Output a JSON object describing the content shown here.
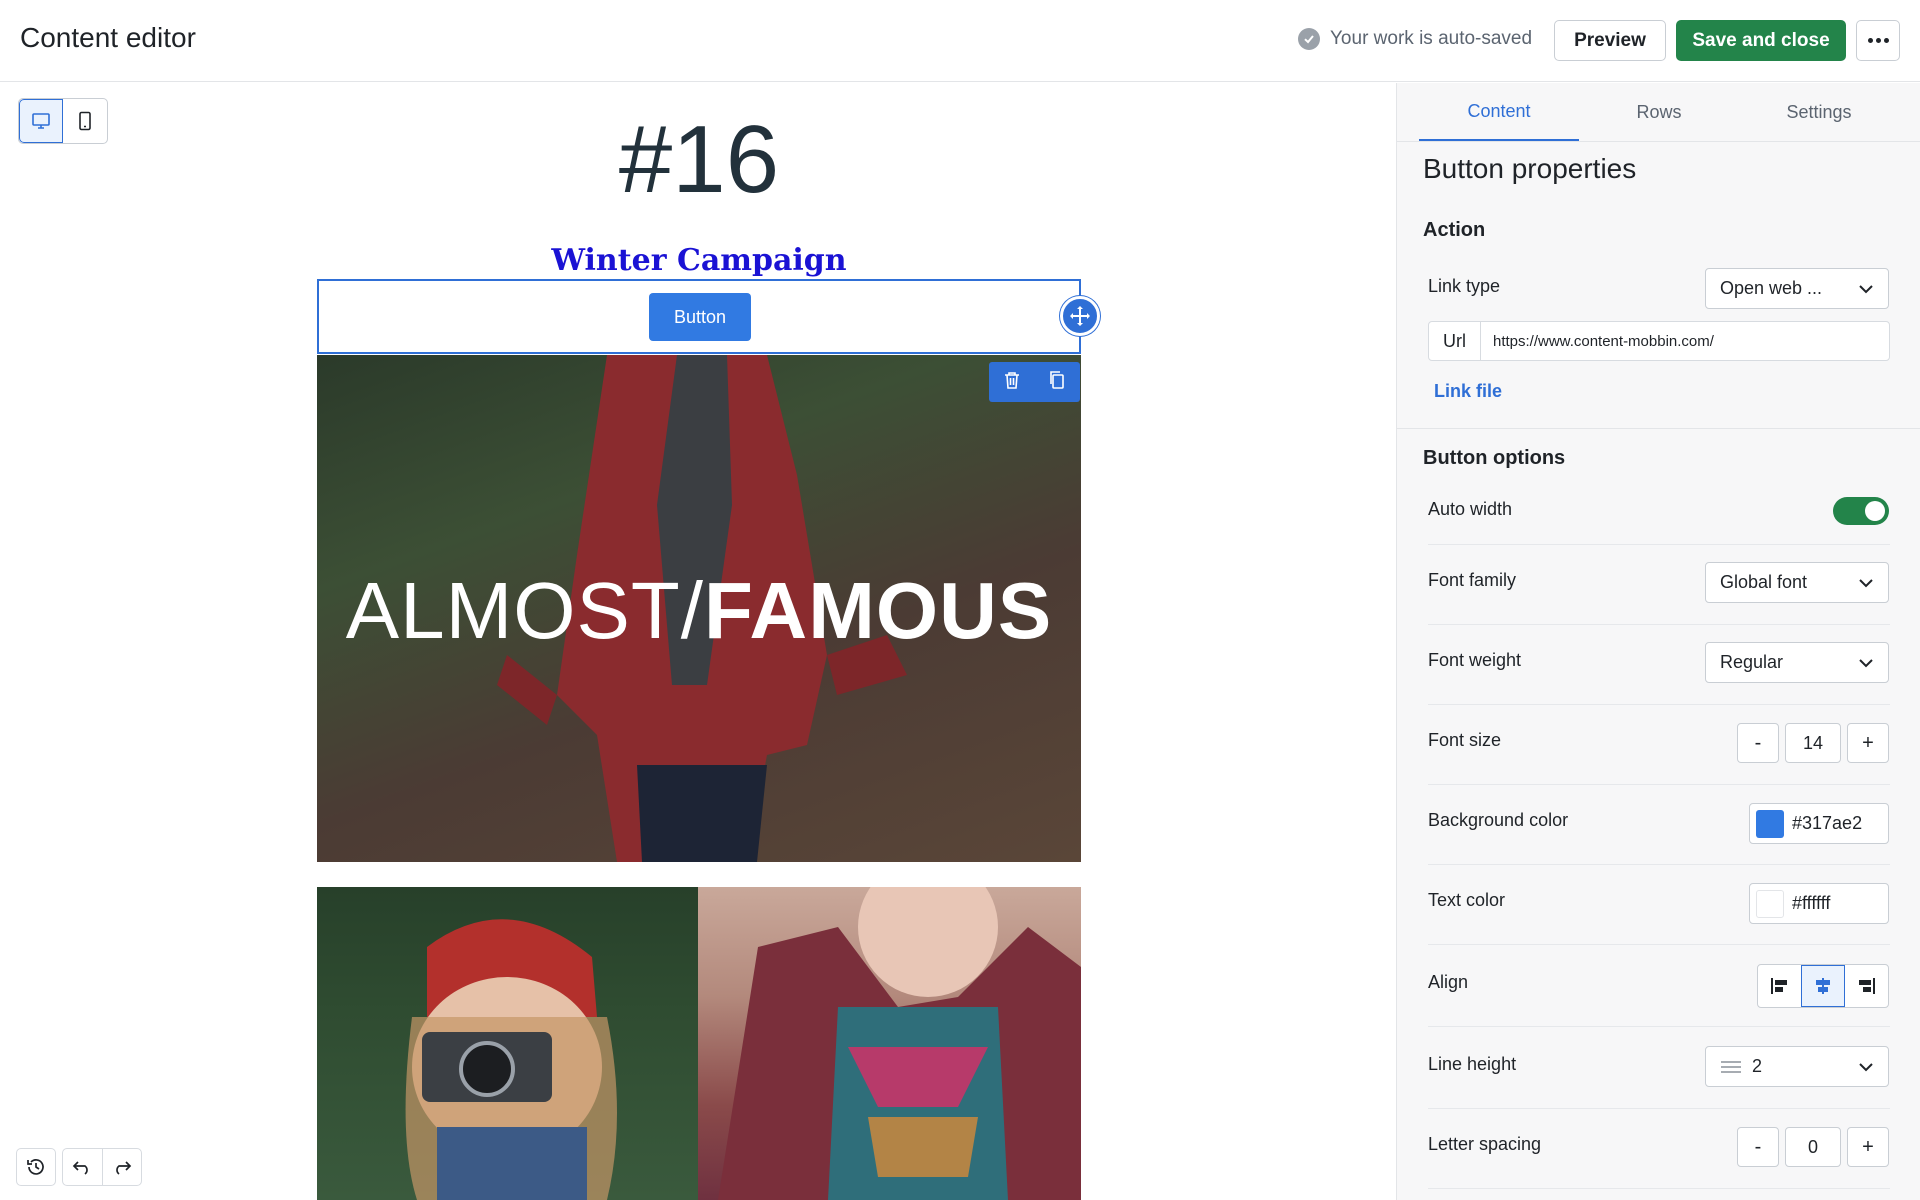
{
  "header": {
    "title": "Content editor",
    "autosave_text": "Your work is auto-saved",
    "preview_label": "Preview",
    "save_label": "Save and close"
  },
  "canvas": {
    "heading": "#16",
    "campaign": "Winter Campaign",
    "button_label": "Button",
    "hero_title_light": "ALMOST",
    "hero_title_slash": "/",
    "hero_title_bold": "FAMOUS"
  },
  "panel": {
    "tabs": [
      {
        "label": "Content",
        "active": true
      },
      {
        "label": "Rows",
        "active": false
      },
      {
        "label": "Settings",
        "active": false
      }
    ],
    "title": "Button properties",
    "action": {
      "section": "Action",
      "link_type_label": "Link type",
      "link_type_value": "Open web ...",
      "url_prefix": "Url",
      "url_value": "https://www.content-mobbin.com/",
      "link_file": "Link file"
    },
    "options": {
      "section": "Button options",
      "auto_width_label": "Auto width",
      "auto_width_on": true,
      "font_family_label": "Font family",
      "font_family_value": "Global font",
      "font_weight_label": "Font weight",
      "font_weight_value": "Regular",
      "font_size_label": "Font size",
      "font_size_value": "14",
      "bg_color_label": "Background color",
      "bg_color_value": "#317ae2",
      "text_color_label": "Text color",
      "text_color_value": "#ffffff",
      "align_label": "Align",
      "align_selected": "center",
      "line_height_label": "Line height",
      "line_height_value": "2",
      "letter_spacing_label": "Letter spacing",
      "letter_spacing_value": "0"
    }
  },
  "colors": {
    "accent": "#2f6fd6",
    "save_green": "#23844a",
    "campaign_blue": "#1a12d4"
  }
}
